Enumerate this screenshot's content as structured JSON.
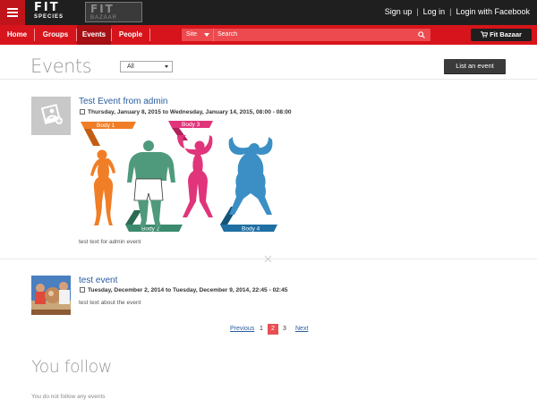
{
  "header": {
    "logo_main_word": "FIT",
    "logo_main_sub": "SPECIES",
    "logo_alt_word": "FIT",
    "logo_alt_sub": "BAZAAR",
    "links": {
      "signup": "Sign up",
      "login": "Log in",
      "facebook": "Login with Facebook"
    }
  },
  "nav": {
    "items": [
      {
        "label": "Home"
      },
      {
        "label": "Groups"
      },
      {
        "label": "Events"
      },
      {
        "label": "People"
      }
    ],
    "active": "Events",
    "search": {
      "scope": "Site",
      "placeholder": "Search"
    },
    "fitbazaar_label": "Fit Bazaar"
  },
  "page": {
    "title": "Events",
    "filter_value": "All",
    "list_event_label": "List an event"
  },
  "events": [
    {
      "title": "Test Event from admin",
      "date": "Thursday, January 8, 2015 to Wednesday, January 14, 2015, 08:00 - 08:00",
      "description": "test text for admin event",
      "banner_labels": [
        "Body 1",
        "Body 2",
        "Body 3",
        "Body 4"
      ]
    },
    {
      "title": "test event",
      "date": "Tuesday, December 2, 2014 to Tuesday, December 9, 2014, 22:45 - 02:45",
      "description": "test text about the event"
    }
  ],
  "pagination": {
    "previous": "Previous",
    "pages": [
      "1",
      "2",
      "3"
    ],
    "current": "2",
    "next": "Next"
  },
  "follow": {
    "title": "You follow",
    "empty": "You do not follow any events"
  },
  "colors": {
    "brand_red": "#d7141b",
    "body1": "#f07e26",
    "body2": "#3c8a6e",
    "body3": "#e0357a",
    "body4": "#1f6fa3"
  },
  "icons": [
    "menu-icon",
    "search-icon",
    "cart-icon",
    "calendar-icon",
    "close-icon",
    "image-placeholder-icon"
  ]
}
